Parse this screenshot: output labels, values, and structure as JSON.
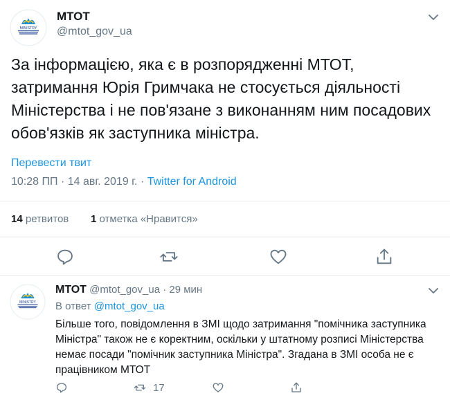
{
  "tweet": {
    "author_name": "МТОТ",
    "author_handle": "@mtot_gov_ua",
    "logo_label": "MINISTRY",
    "text": "За інформацією, яка є в розпорядженні МТОТ, затримання Юрія Гримчака не стосується діяльності Міністерства і не пов'язане з виконанням ним посадових обов'язків як заступника міністра.",
    "translate_label": "Перевести твит",
    "time": "10:28 ПП",
    "date": "14 авг. 2019 г.",
    "separator": "·",
    "source": "Twitter for Android",
    "retweets_count": "14",
    "retweets_label": "ретвитов",
    "likes_count": "1",
    "likes_label": "отметка «Нравится»"
  },
  "reply": {
    "author_name": "МТОТ",
    "author_handle": "@mtot_gov_ua",
    "time_ago": "29 мин",
    "separator": "·",
    "in_reply_label": "В ответ",
    "in_reply_handle": "@mtot_gov_ua",
    "logo_label": "MINISTRY",
    "text": "Більше того, повідомлення в ЗМІ щодо затримання \"помічника заступника Міністра\" також не є коректним, оскільки у штатному розписі Міністерства немає посади \"помічник заступника Міністра\". Згадана в ЗМІ особа не є працівником МТОТ",
    "retweet_count": "17"
  },
  "colors": {
    "accent": "#1b95e0",
    "muted": "#657786",
    "text": "#14171a",
    "border": "#e6ecf0"
  },
  "icons": [
    "chevron-down-icon",
    "reply-icon",
    "retweet-icon",
    "like-icon",
    "share-icon",
    "ministry-logo"
  ]
}
